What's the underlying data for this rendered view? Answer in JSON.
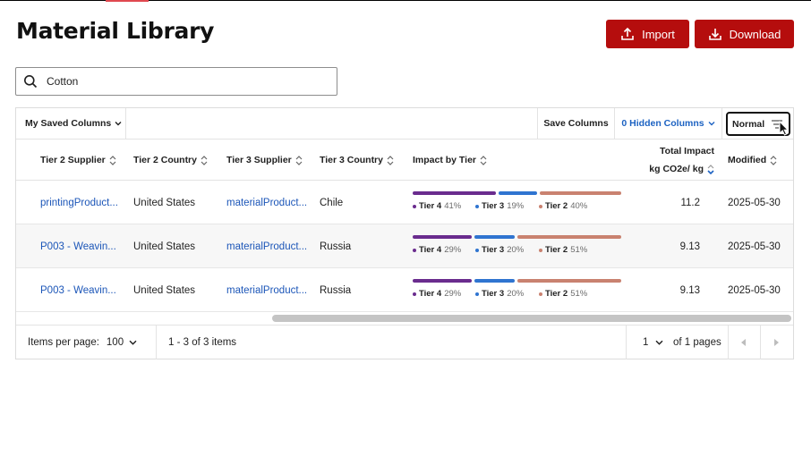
{
  "page": {
    "title": "Material Library"
  },
  "actions": {
    "import_label": "Import",
    "download_label": "Download"
  },
  "search": {
    "value": "Cotton",
    "placeholder": ""
  },
  "toolbar": {
    "saved_columns_label": "My Saved Columns",
    "save_columns_label": "Save Columns",
    "hidden_columns_label": "0 Hidden Columns",
    "density_label": "Normal"
  },
  "columns": {
    "tier2_supplier": "Tier 2 Supplier",
    "tier2_country": "Tier 2 Country",
    "tier3_supplier": "Tier 3 Supplier",
    "tier3_country": "Tier 3 Country",
    "impact_by_tier": "Impact by Tier",
    "total_impact_line1": "Total Impact",
    "total_impact_line2": "kg CO2e/ kg",
    "modified": "Modified"
  },
  "tier_colors": {
    "tier4": "#6a2c8e",
    "tier3": "#2f74d0",
    "tier2": "#c98270"
  },
  "rows": [
    {
      "tier2_supplier": "printingProduct...",
      "tier2_country": "United States",
      "tier3_supplier": "materialProduct...",
      "tier3_country": "Chile",
      "impact": [
        {
          "label": "Tier 4",
          "pct_text": "41%",
          "pct": 41
        },
        {
          "label": "Tier 3",
          "pct_text": "19%",
          "pct": 19
        },
        {
          "label": "Tier 2",
          "pct_text": "40%",
          "pct": 40
        }
      ],
      "total_impact": "11.2",
      "modified": "2025-05-30"
    },
    {
      "tier2_supplier": "P003 - Weavin...",
      "tier2_country": "United States",
      "tier3_supplier": "materialProduct...",
      "tier3_country": "Russia",
      "impact": [
        {
          "label": "Tier 4",
          "pct_text": "29%",
          "pct": 29
        },
        {
          "label": "Tier 3",
          "pct_text": "20%",
          "pct": 20
        },
        {
          "label": "Tier 2",
          "pct_text": "51%",
          "pct": 51
        }
      ],
      "total_impact": "9.13",
      "modified": "2025-05-30"
    },
    {
      "tier2_supplier": "P003 - Weavin...",
      "tier2_country": "United States",
      "tier3_supplier": "materialProduct...",
      "tier3_country": "Russia",
      "impact": [
        {
          "label": "Tier 4",
          "pct_text": "29%",
          "pct": 29
        },
        {
          "label": "Tier 3",
          "pct_text": "20%",
          "pct": 20
        },
        {
          "label": "Tier 2",
          "pct_text": "51%",
          "pct": 51
        }
      ],
      "total_impact": "9.13",
      "modified": "2025-05-30"
    }
  ],
  "pagination": {
    "items_per_page_label": "Items per page:",
    "items_per_page_value": "100",
    "range_text": "1 - 3 of 3 items",
    "current_page": "1",
    "pages_text": "of 1 pages"
  }
}
